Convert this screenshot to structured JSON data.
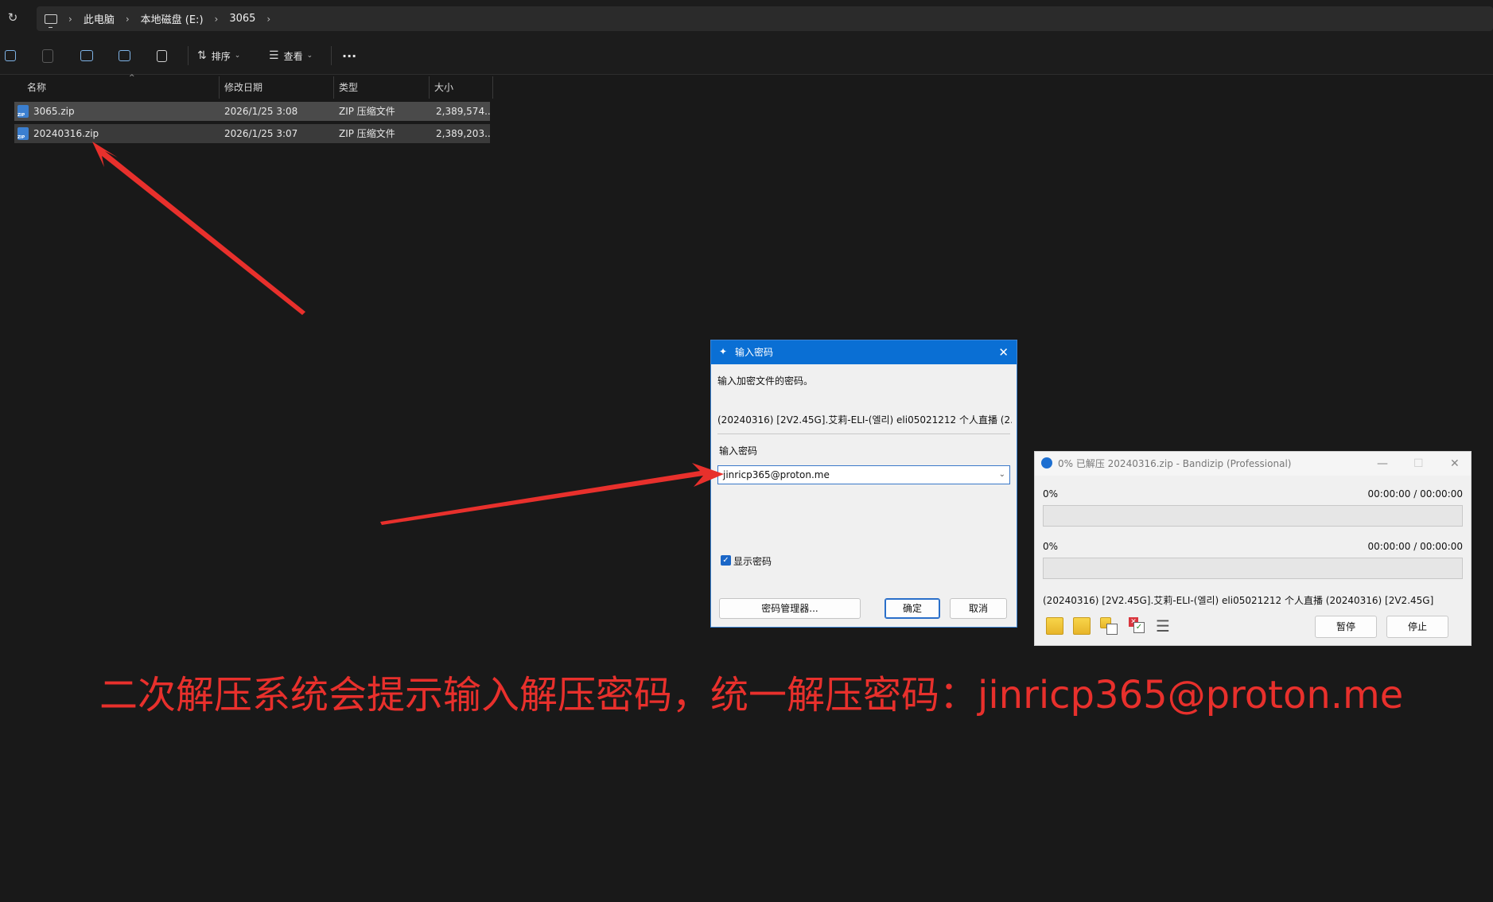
{
  "address": {
    "crumbs": [
      "此电脑",
      "本地磁盘 (E:)",
      "3065"
    ]
  },
  "toolbar": {
    "sort_label": "排序",
    "view_label": "查看",
    "more_label": "···"
  },
  "columns": {
    "name": "名称",
    "modified": "修改日期",
    "type": "类型",
    "size": "大小"
  },
  "files": [
    {
      "name": "3065.zip",
      "modified": "2026/1/25 3:08",
      "type": "ZIP 压缩文件",
      "size": "2,389,574..."
    },
    {
      "name": "20240316.zip",
      "modified": "2026/1/25 3:07",
      "type": "ZIP 压缩文件",
      "size": "2,389,203..."
    }
  ],
  "password_dialog": {
    "title": "输入密码",
    "close": "✕",
    "instruction": "输入加密文件的密码。",
    "file_name": "(20240316) [2V2.45G].艾莉-ELI-(엘리) eli05021212 个人直播 (2...",
    "input_label": "输入密码",
    "password_value": "jinricp365@proton.me",
    "show_password_label": "显示密码",
    "manager_button": "密码管理器...",
    "ok_button": "确定",
    "cancel_button": "取消"
  },
  "bandizip": {
    "title": "0% 已解压 20240316.zip - Bandizip (Professional)",
    "progress1_percent": "0%",
    "progress1_time": "00:00:00 / 00:00:00",
    "progress2_percent": "0%",
    "progress2_time": "00:00:00 / 00:00:00",
    "current_file": "(20240316) [2V2.45G].艾莉-ELI-(엘리) eli05021212 个人直播 (20240316) [2V2.45G]",
    "pause_button": "暂停",
    "stop_button": "停止"
  },
  "caption": "二次解压系统会提示输入解压密码，统一解压密码：jinricp365@proton.me",
  "colors": {
    "accent": "#0a6fd4",
    "annotation": "#e8302c"
  }
}
